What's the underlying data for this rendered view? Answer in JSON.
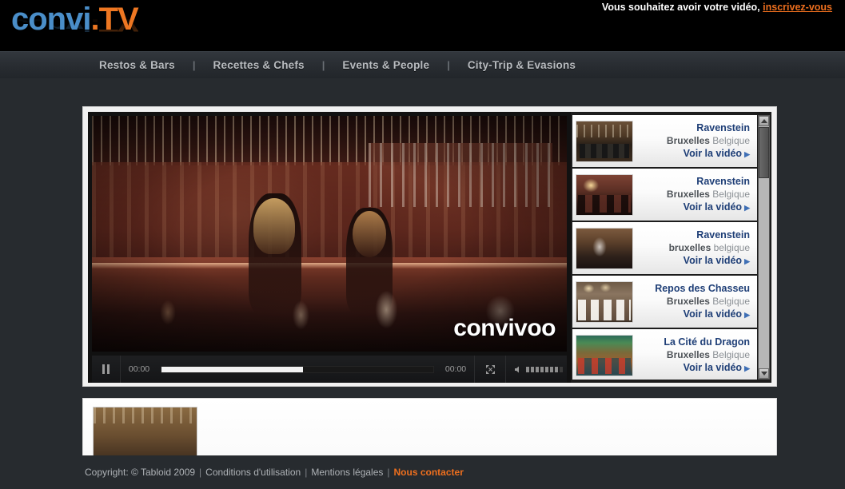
{
  "header": {
    "logo": {
      "part1": "convi",
      "dot": ".",
      "part2": "TV"
    },
    "signup_prompt": "Vous souhaitez avoir votre vidéo,",
    "signup_link": "inscrivez-vous"
  },
  "nav": {
    "separator": "|",
    "items": [
      {
        "label": "Restos & Bars"
      },
      {
        "label": "Recettes & Chefs"
      },
      {
        "label": "Events & People"
      },
      {
        "label": "City-Trip & Evasions"
      }
    ]
  },
  "player": {
    "watermark": "convivoo",
    "controls": {
      "pause_label": "pause",
      "current_time": "00:00",
      "total_time": "00:00",
      "progress_percent": 52,
      "fullscreen_label": "fullscreen",
      "volume_level": 7,
      "volume_total": 8
    }
  },
  "playlist": {
    "items": [
      {
        "title": "Ravenstein",
        "city": "Bruxelles",
        "country": "Belgique",
        "cta": "Voir la vidéo",
        "arrow": "▶",
        "thumb": "th1"
      },
      {
        "title": "Ravenstein",
        "city": "Bruxelles",
        "country": "Belgique",
        "cta": "Voir la vidéo",
        "arrow": "▶",
        "thumb": "th2"
      },
      {
        "title": "Ravenstein",
        "city": "bruxelles",
        "country": "belgique",
        "cta": "Voir la vidéo",
        "arrow": "▶",
        "thumb": "th3"
      },
      {
        "title": "Repos des Chasseu",
        "city": "Bruxelles",
        "country": "Belgique",
        "cta": "Voir la vidéo",
        "arrow": "▶",
        "thumb": "th4"
      },
      {
        "title": "La Cité du Dragon",
        "city": "Bruxelles",
        "country": "Belgique",
        "cta": "Voir la vidéo",
        "arrow": "▶",
        "thumb": "th5"
      }
    ]
  },
  "lower": {
    "thumb": "th6"
  },
  "footer": {
    "copyright": "Copyright: © Tabloid 2009",
    "sep": "|",
    "terms": "Conditions d'utilisation",
    "legal": "Mentions légales",
    "contact": "Nous contacter"
  },
  "colors": {
    "brand_blue": "#4a8ec9",
    "brand_orange": "#ee7722",
    "link_orange": "#ee6f1e",
    "title_navy": "#1f3f77",
    "page_bg": "#272b2f"
  }
}
